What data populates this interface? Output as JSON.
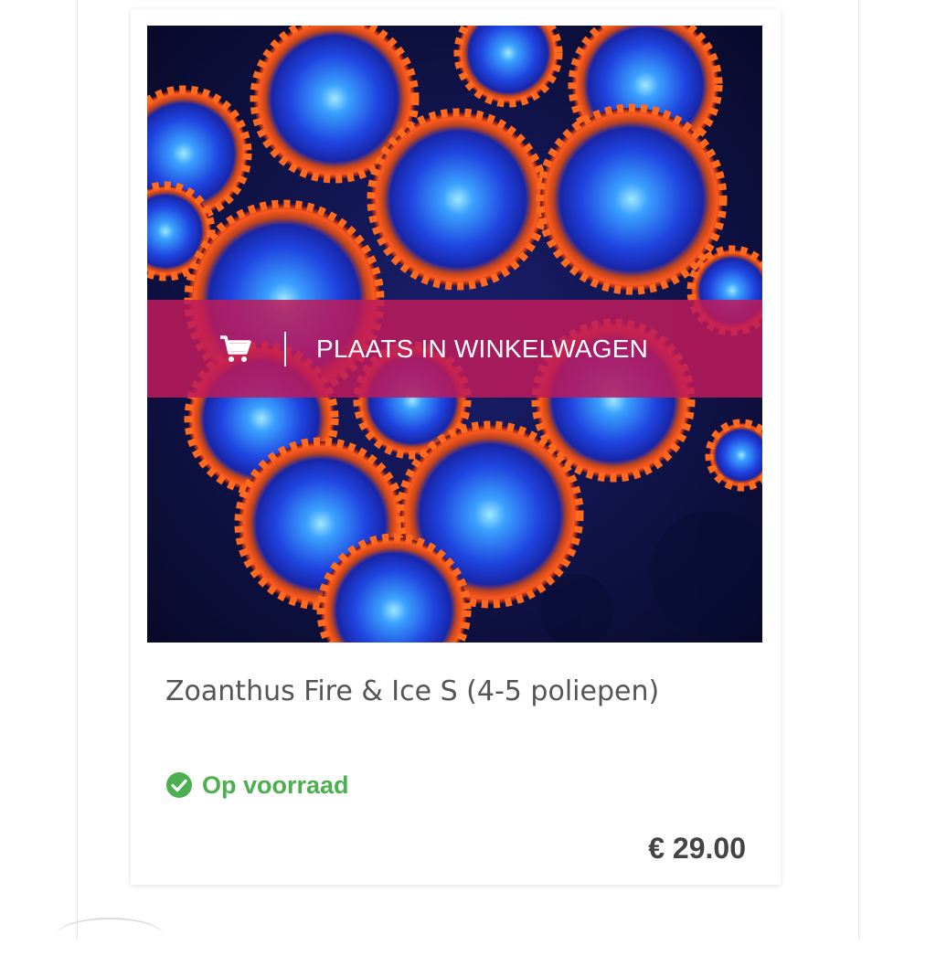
{
  "product": {
    "title": "Zoanthus Fire & Ice S (4-5 poliepen)",
    "image_alt": "Zoanthus Fire & Ice coral polyps",
    "cart_button_label": "PLAATS IN WINKELWAGEN",
    "stock_label": "Op voorraad",
    "price": "€ 29.00"
  },
  "icons": {
    "cart": "shopping-cart-icon",
    "stock": "check-circle-icon"
  },
  "colors": {
    "cart_bar": "#be1b5b",
    "stock_green": "#4caf50",
    "price_text": "#444444",
    "title_text": "#555555"
  }
}
